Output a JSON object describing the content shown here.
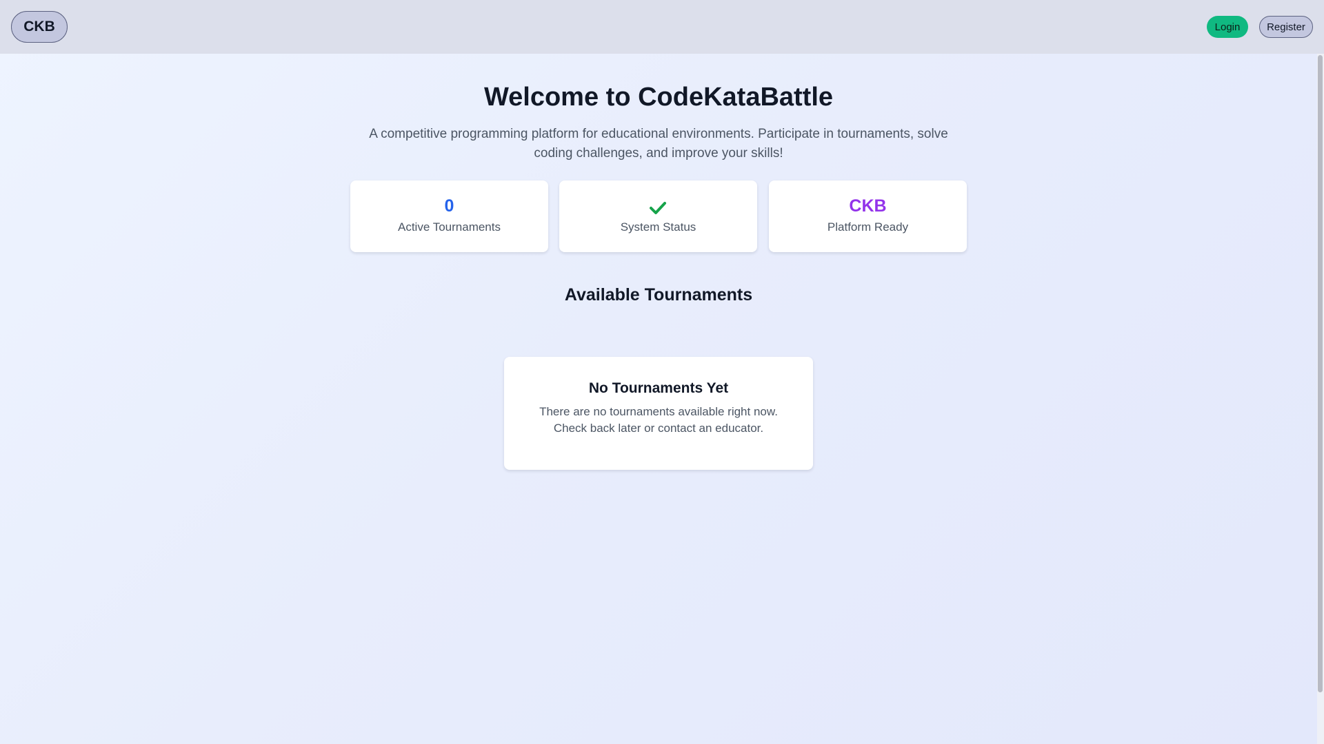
{
  "header": {
    "logo_label": "CKB",
    "login_label": "Login",
    "register_label": "Register"
  },
  "hero": {
    "title": "Welcome to CodeKataBattle",
    "subtitle": "A competitive programming platform for educational environments. Participate in tournaments, solve coding challenges, and improve your skills!"
  },
  "stats": [
    {
      "value": "0",
      "label": "Active Tournaments",
      "color": "#2563eb"
    },
    {
      "value": "",
      "icon": "check-icon",
      "label": "System Status",
      "color": "#16a34a"
    },
    {
      "value": "CKB",
      "label": "Platform Ready",
      "color": "#9333ea"
    }
  ],
  "tournaments": {
    "section_title": "Available Tournaments",
    "empty_title": "No Tournaments Yet",
    "empty_text": "There are no tournaments available right now. Check back later or contact an educator."
  },
  "colors": {
    "login_bg": "#10b981",
    "header_bg": "#dcdfeb"
  }
}
